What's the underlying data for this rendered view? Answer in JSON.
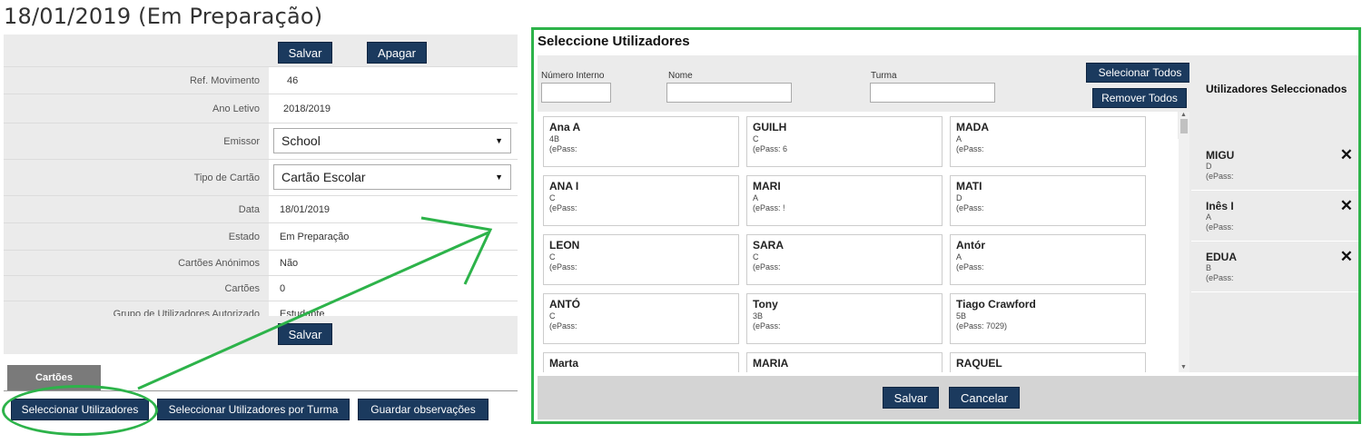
{
  "page": {
    "title": "18/01/2019 (Em Preparação)"
  },
  "form": {
    "save_label": "Salvar",
    "delete_label": "Apagar",
    "fields": [
      {
        "label": "Ref. Movimento",
        "value": "46"
      },
      {
        "label": "Ano Letivo",
        "value": "2018/2019"
      },
      {
        "label": "Emissor",
        "value": "School"
      },
      {
        "label": "Tipo de Cartão",
        "value": "Cartão Escolar"
      },
      {
        "label": "Data",
        "value": "18/01/2019"
      },
      {
        "label": "Estado",
        "value": "Em Preparação"
      },
      {
        "label": "Cartões Anónimos",
        "value": "Não"
      },
      {
        "label": "Cartões",
        "value": "0"
      },
      {
        "label": "Grupo de Utilizadores Autorizado",
        "value": "Estudante"
      }
    ],
    "bottom_save_label": "Salvar"
  },
  "tabs": {
    "cartoes": "Cartões"
  },
  "actions": {
    "select_users": "Seleccionar Utilizadores",
    "select_users_by_class": "Seleccionar Utilizadores por Turma",
    "save_notes": "Guardar observações"
  },
  "modal": {
    "title": "Seleccione Utilizadores",
    "filters": {
      "numero_label": "Número Interno",
      "nome_label": "Nome",
      "turma_label": "Turma"
    },
    "select_all_label": "Selecionar Todos",
    "remove_all_label": "Remover Todos",
    "selected_title": "Utilizadores Seleccionados",
    "users": [
      {
        "name": "Ana A",
        "turma": "4B",
        "epass": "(ePass:"
      },
      {
        "name": "GUILH",
        "turma": "C",
        "epass": "(ePass: 6"
      },
      {
        "name": "MADA",
        "turma": "A",
        "epass": "(ePass:"
      },
      {
        "name": "ANA I",
        "turma": "C",
        "epass": "(ePass:"
      },
      {
        "name": "MARI",
        "turma": "A",
        "epass": "(ePass: !"
      },
      {
        "name": "MATI",
        "turma": "D",
        "epass": "(ePass:"
      },
      {
        "name": "LEON",
        "turma": "C",
        "epass": "(ePass:"
      },
      {
        "name": "SARA",
        "turma": "C",
        "epass": "(ePass:"
      },
      {
        "name": "Antór",
        "turma": "A",
        "epass": "(ePass:"
      },
      {
        "name": "ANTÓ",
        "turma": "C",
        "epass": "(ePass:"
      },
      {
        "name": "Tony",
        "turma": "3B",
        "epass": "(ePass:"
      },
      {
        "name": "Tiago Crawford",
        "turma": "5B",
        "epass": "(ePass: 7029)"
      },
      {
        "name": "Marta",
        "turma": "",
        "epass": ""
      },
      {
        "name": "MARIA",
        "turma": "",
        "epass": ""
      },
      {
        "name": "RAQUEL",
        "turma": "",
        "epass": ""
      }
    ],
    "selected_users": [
      {
        "name": "MIGU",
        "turma": "D",
        "epass": "(ePass:"
      },
      {
        "name": "Inês I",
        "turma": "A",
        "epass": "(ePass:"
      },
      {
        "name": "EDUA",
        "turma": "B",
        "epass": "(ePass:"
      }
    ],
    "close_symbol": "✕",
    "save_label": "Salvar",
    "cancel_label": "Cancelar"
  },
  "colors": {
    "button": "#1b3a5e",
    "highlight": "#2db34a",
    "panel": "#ebebeb"
  }
}
